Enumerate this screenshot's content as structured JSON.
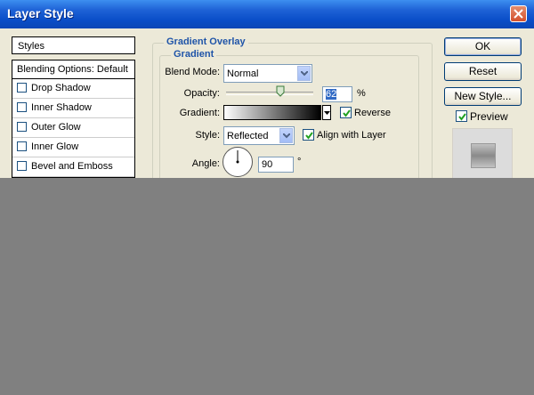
{
  "window": {
    "title": "Layer Style"
  },
  "styles_panel": {
    "header": "Styles",
    "blending_options": "Blending Options: Default",
    "items": [
      {
        "label": "Drop Shadow",
        "checked": false
      },
      {
        "label": "Inner Shadow",
        "checked": false
      },
      {
        "label": "Outer Glow",
        "checked": false
      },
      {
        "label": "Inner Glow",
        "checked": false
      },
      {
        "label": "Bevel and Emboss",
        "checked": false
      }
    ]
  },
  "gradient_overlay": {
    "group_title": "Gradient Overlay",
    "subgroup_title": "Gradient",
    "blend_mode": {
      "label": "Blend Mode:",
      "value": "Normal"
    },
    "opacity": {
      "label": "Opacity:",
      "value": "62",
      "unit": "%",
      "slider_fraction": 0.62
    },
    "gradient": {
      "label": "Gradient:",
      "reverse_label": "Reverse",
      "reverse_checked": true
    },
    "style": {
      "label": "Style:",
      "value": "Reflected",
      "align_label": "Align with Layer",
      "align_checked": true
    },
    "angle": {
      "label": "Angle:",
      "value": "90",
      "unit": "°"
    }
  },
  "buttons": {
    "ok": "OK",
    "reset": "Reset",
    "new_style": "New Style..."
  },
  "preview": {
    "label": "Preview",
    "checked": true
  },
  "colors": {
    "title_bar": "#0a4ec8",
    "legend_blue": "#1f54a8",
    "dialog_bg": "#ece9d8"
  }
}
